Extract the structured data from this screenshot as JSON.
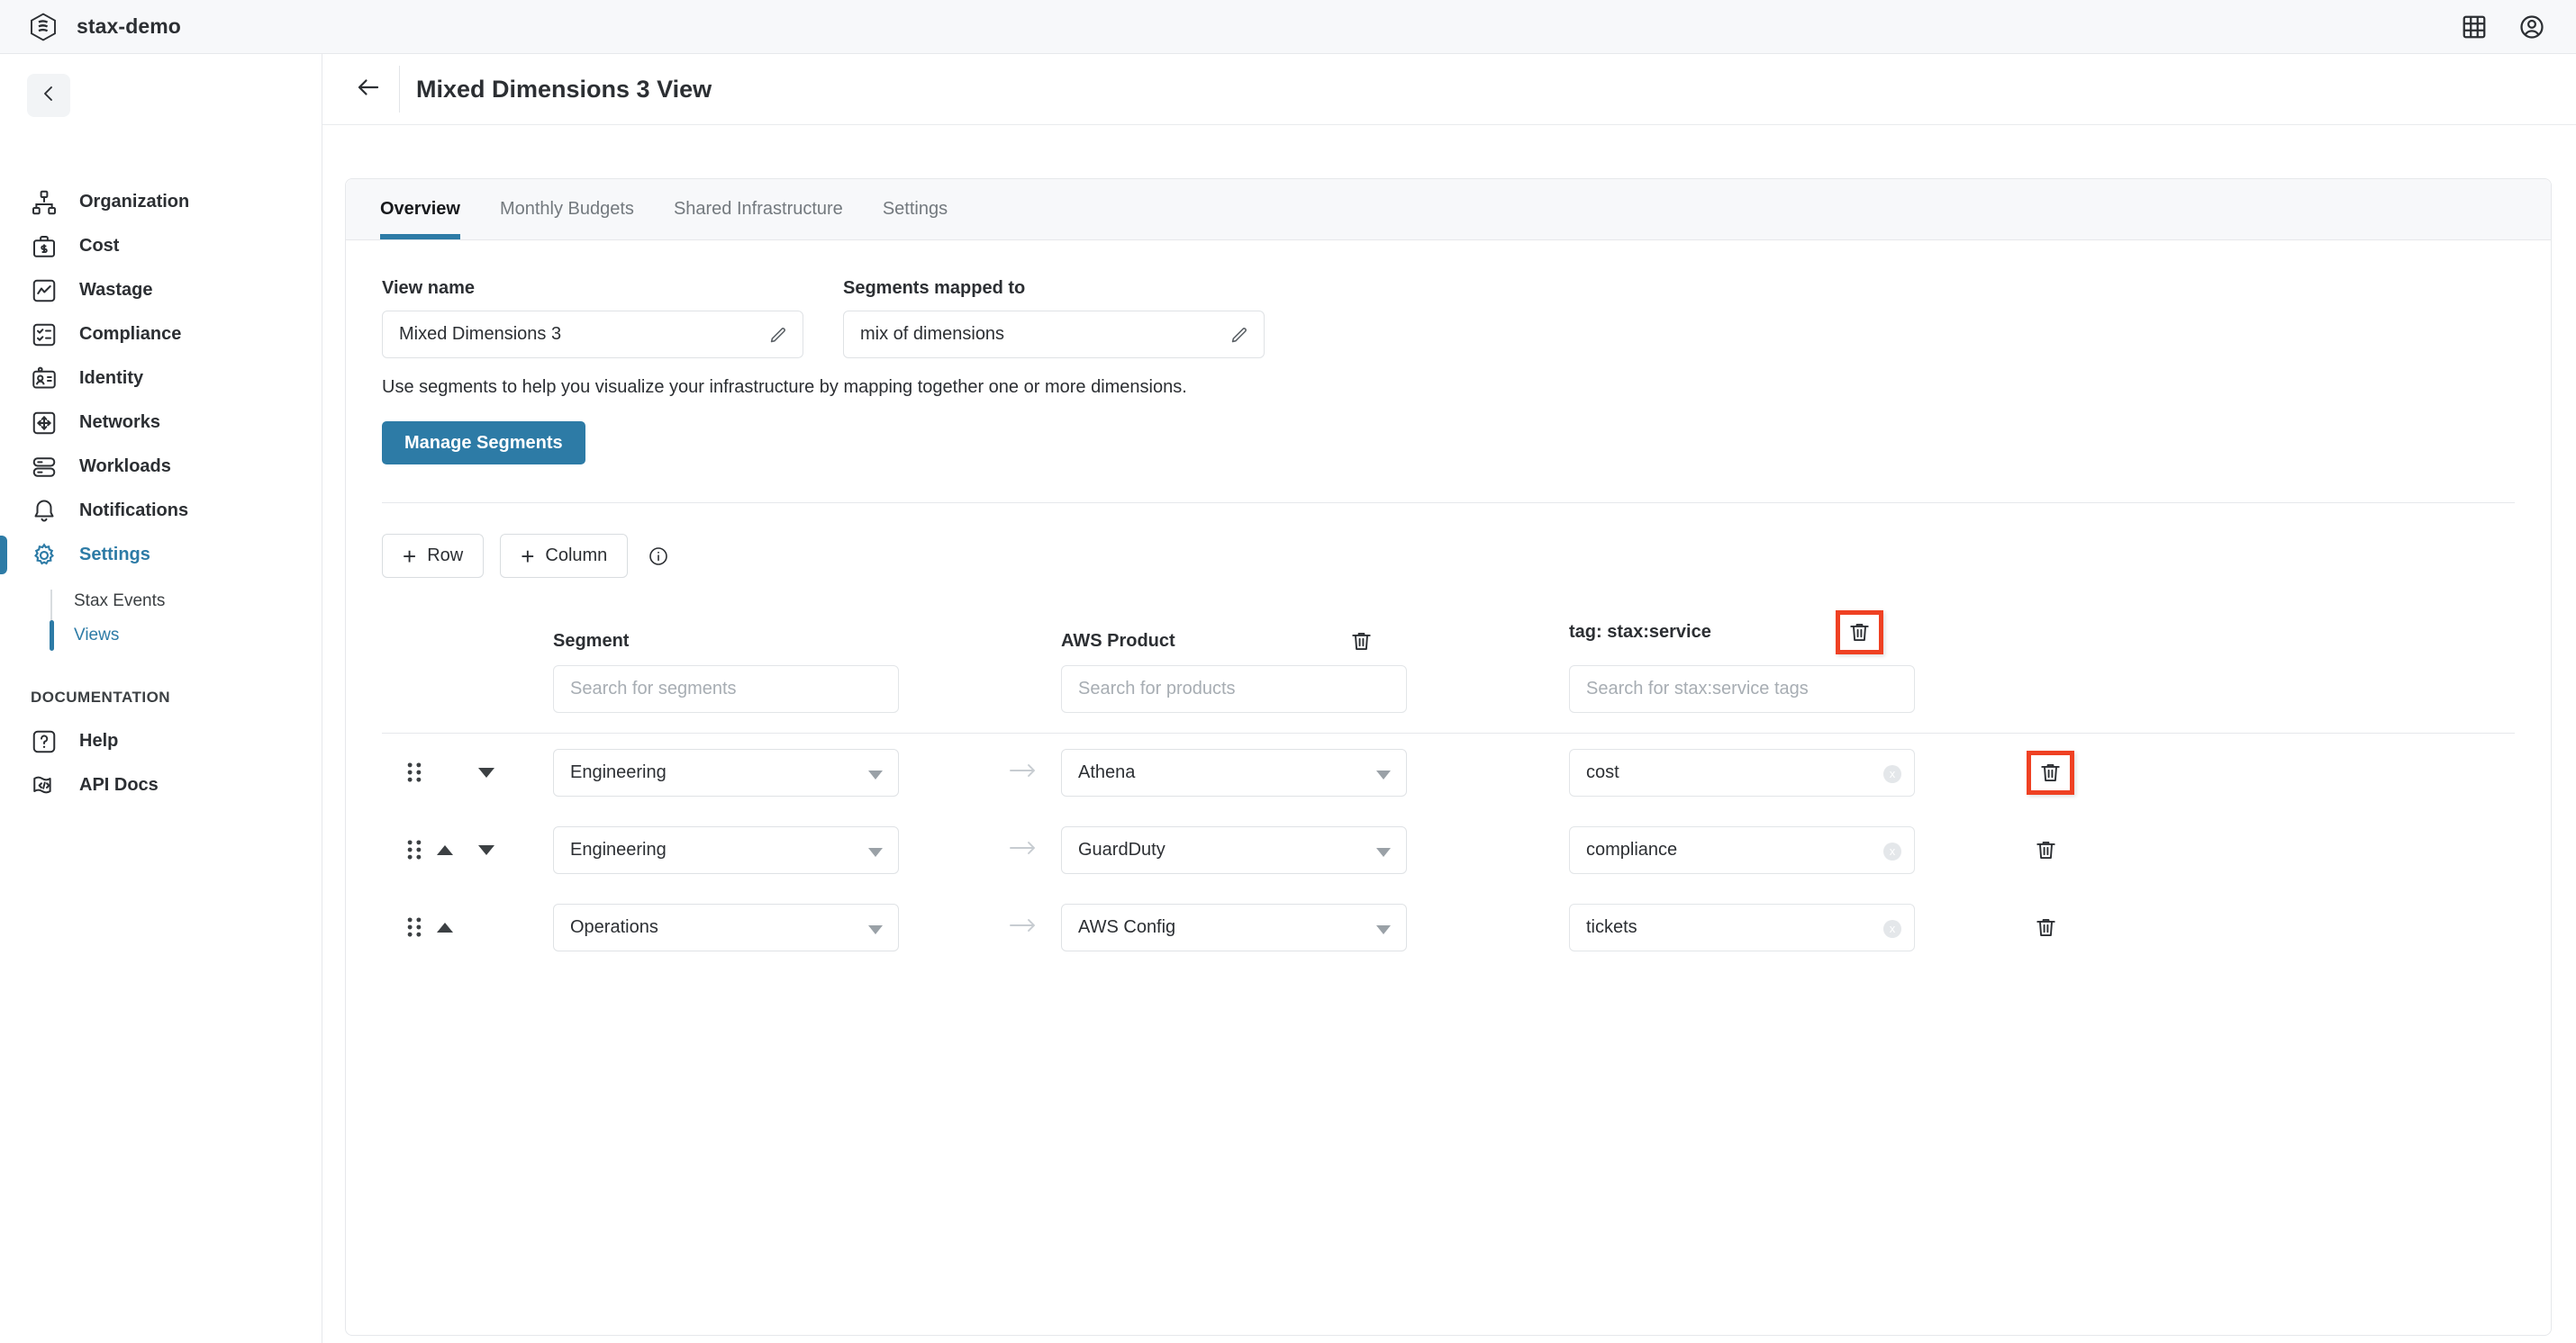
{
  "topbar": {
    "brand_name": "stax-demo",
    "logo_icon": "stax-hexagon-logo",
    "apps_icon": "grid-apps-icon",
    "account_icon": "user-account-icon"
  },
  "sidebar": {
    "collapse_icon": "chevron-left-icon",
    "items": [
      {
        "label": "Organization",
        "icon": "org-chart-icon"
      },
      {
        "label": "Cost",
        "icon": "briefcase-dollar-icon"
      },
      {
        "label": "Wastage",
        "icon": "chart-line-icon"
      },
      {
        "label": "Compliance",
        "icon": "checklist-icon"
      },
      {
        "label": "Identity",
        "icon": "id-card-icon"
      },
      {
        "label": "Networks",
        "icon": "move-arrows-icon"
      },
      {
        "label": "Workloads",
        "icon": "server-stack-icon"
      },
      {
        "label": "Notifications",
        "icon": "bell-icon"
      },
      {
        "label": "Settings",
        "icon": "gear-icon"
      }
    ],
    "subitems": [
      {
        "label": "Stax Events"
      },
      {
        "label": "Views"
      }
    ],
    "section_label": "DOCUMENTATION",
    "doc_items": [
      {
        "label": "Help",
        "icon": "question-mark-icon"
      },
      {
        "label": "API Docs",
        "icon": "code-brackets-icon"
      }
    ]
  },
  "page": {
    "back_icon": "arrow-left-icon",
    "title": "Mixed Dimensions 3 View"
  },
  "tabs": [
    {
      "label": "Overview"
    },
    {
      "label": "Monthly Budgets"
    },
    {
      "label": "Shared Infrastructure"
    },
    {
      "label": "Settings"
    }
  ],
  "overview": {
    "view_name_label": "View name",
    "view_name_value": "Mixed Dimensions 3",
    "segments_label": "Segments mapped to",
    "segments_value": "mix of dimensions",
    "edit_icon": "pencil-icon",
    "helper_text": "Use segments to help you visualize your infrastructure by mapping together one or more dimensions.",
    "manage_segments_label": "Manage Segments"
  },
  "builder": {
    "add_row_label": "Row",
    "add_column_label": "Column",
    "plus_glyph": "+",
    "info_icon": "info-circle-icon",
    "columns": [
      {
        "header": "Segment",
        "placeholder": "Search for segments",
        "deletable": false,
        "highlighted": false
      },
      {
        "header": "AWS Product",
        "placeholder": "Search for products",
        "deletable": true,
        "highlighted": false,
        "delete_icon": "trash-icon"
      },
      {
        "header": "tag: stax:service",
        "placeholder": "Search for stax:service tags",
        "deletable": true,
        "highlighted": true,
        "delete_icon": "trash-icon"
      }
    ],
    "rows": [
      {
        "handle_icon": "drag-handle-icon",
        "move_up": false,
        "move_down": true,
        "segment": "Engineering",
        "product": "Athena",
        "tag": "cost",
        "clear_glyph": "x",
        "delete_icon": "trash-icon",
        "delete_highlighted": true
      },
      {
        "handle_icon": "drag-handle-icon",
        "move_up": true,
        "move_down": true,
        "segment": "Engineering",
        "product": "GuardDuty",
        "tag": "compliance",
        "clear_glyph": "x",
        "delete_icon": "trash-icon",
        "delete_highlighted": false
      },
      {
        "handle_icon": "drag-handle-icon",
        "move_up": true,
        "move_down": false,
        "segment": "Operations",
        "product": "AWS Config",
        "tag": "tickets",
        "clear_glyph": "x",
        "delete_icon": "trash-icon",
        "delete_highlighted": false
      }
    ],
    "row_arrow_icon": "arrow-right-icon"
  },
  "colors": {
    "accent": "#2d7ba6",
    "highlight": "#ef4123",
    "topbar_bg": "#f7f8fa",
    "text": "#2c2f33",
    "muted": "#73797e"
  }
}
